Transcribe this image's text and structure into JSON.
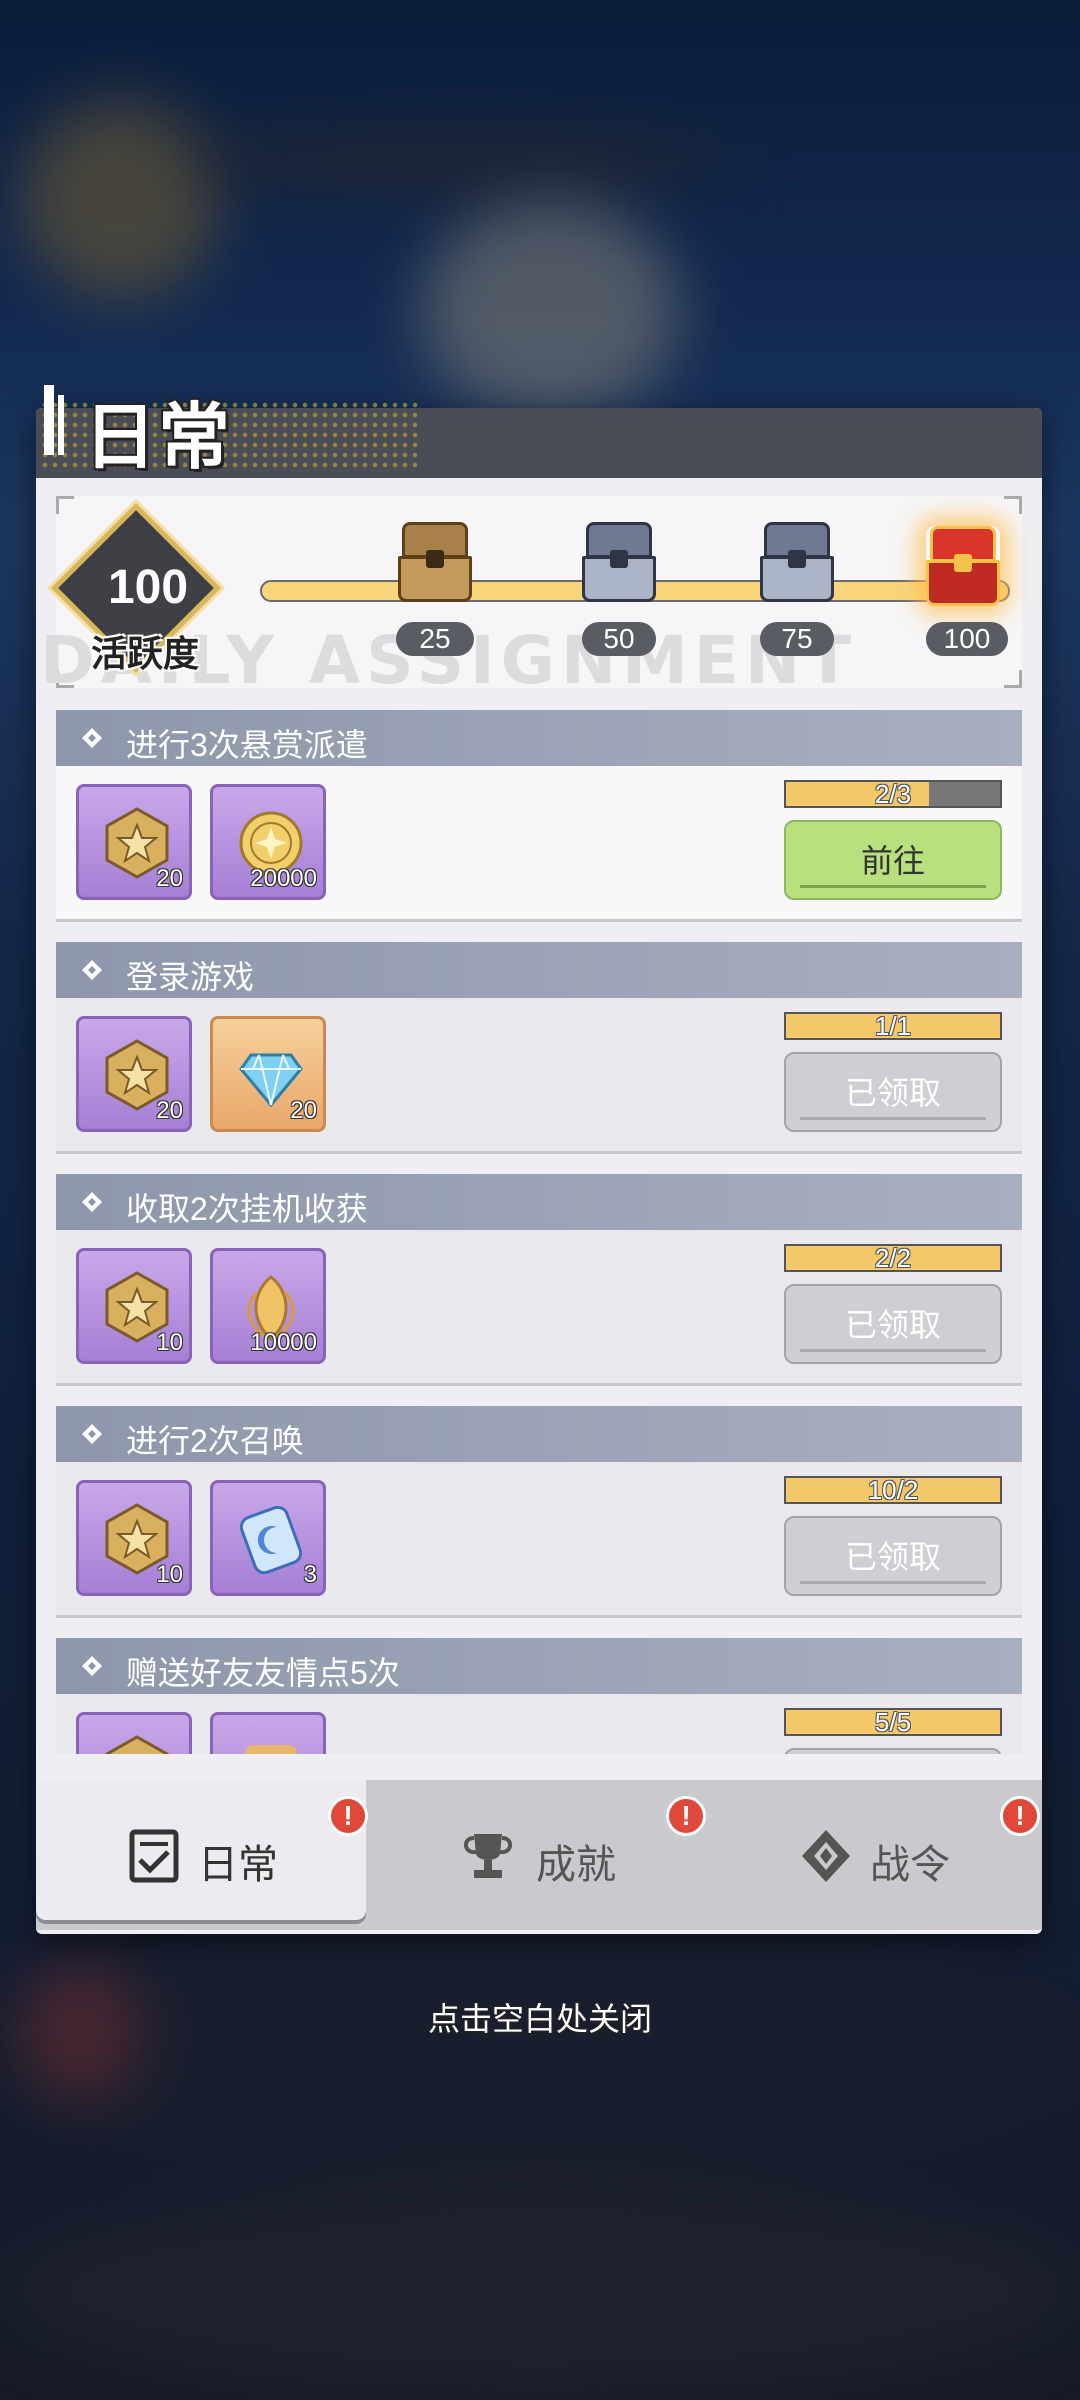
{
  "panel": {
    "title": "日常",
    "watermark": "DAILY ASSIGNMENT"
  },
  "activity": {
    "value": "100",
    "label": "活跃度",
    "progress_fraction": 1.0,
    "milestones": [
      {
        "value": "25",
        "chest": "wooden-chest-icon",
        "opened": true
      },
      {
        "value": "50",
        "chest": "iron-chest-icon",
        "opened": true
      },
      {
        "value": "75",
        "chest": "iron-chest-icon",
        "opened": true
      },
      {
        "value": "100",
        "chest": "red-gold-chest-icon",
        "opened": false
      }
    ]
  },
  "tasks": [
    {
      "title": "进行3次悬赏派遣",
      "rewards": [
        {
          "icon": "star-medal-icon",
          "count": "20",
          "bg": "purple"
        },
        {
          "icon": "gold-coin-icon",
          "count": "20000",
          "bg": "purple"
        }
      ],
      "progress_text": "2/3",
      "progress_fraction": 0.67,
      "button": "前往",
      "state": "go"
    },
    {
      "title": "登录游戏",
      "rewards": [
        {
          "icon": "star-medal-icon",
          "count": "20",
          "bg": "purple"
        },
        {
          "icon": "diamond-icon",
          "count": "20",
          "bg": "orange"
        }
      ],
      "progress_text": "1/1",
      "progress_fraction": 1.0,
      "button": "已领取",
      "state": "done"
    },
    {
      "title": "收取2次挂机收获",
      "rewards": [
        {
          "icon": "star-medal-icon",
          "count": "10",
          "bg": "purple"
        },
        {
          "icon": "golden-leaf-icon",
          "count": "10000",
          "bg": "purple"
        }
      ],
      "progress_text": "2/2",
      "progress_fraction": 1.0,
      "button": "已领取",
      "state": "done"
    },
    {
      "title": "进行2次召唤",
      "rewards": [
        {
          "icon": "star-medal-icon",
          "count": "10",
          "bg": "purple"
        },
        {
          "icon": "moon-ticket-icon",
          "count": "3",
          "bg": "purple"
        }
      ],
      "progress_text": "10/2",
      "progress_fraction": 1.0,
      "button": "已领取",
      "state": "done"
    },
    {
      "title": "赠送好友友情点5次",
      "rewards": [
        {
          "icon": "star-medal-icon",
          "count": "",
          "bg": "purple"
        },
        {
          "icon": "friendship-icon",
          "count": "",
          "bg": "purple"
        }
      ],
      "progress_text": "5/5",
      "progress_fraction": 1.0,
      "button": "",
      "state": "done"
    }
  ],
  "tabs": [
    {
      "label": "日常",
      "icon": "checklist-icon",
      "active": true,
      "alert": "!"
    },
    {
      "label": "成就",
      "icon": "trophy-icon",
      "active": false,
      "alert": "!"
    },
    {
      "label": "战令",
      "icon": "emblem-icon",
      "active": false,
      "alert": "!"
    }
  ],
  "close_hint": "点击空白处关闭",
  "colors": {
    "accent_gold": "#f3c869",
    "go_button": "#b8e07e",
    "done_button": "#cfcfd3",
    "task_header": "#8e96ab",
    "alert_red": "#e0483a"
  }
}
